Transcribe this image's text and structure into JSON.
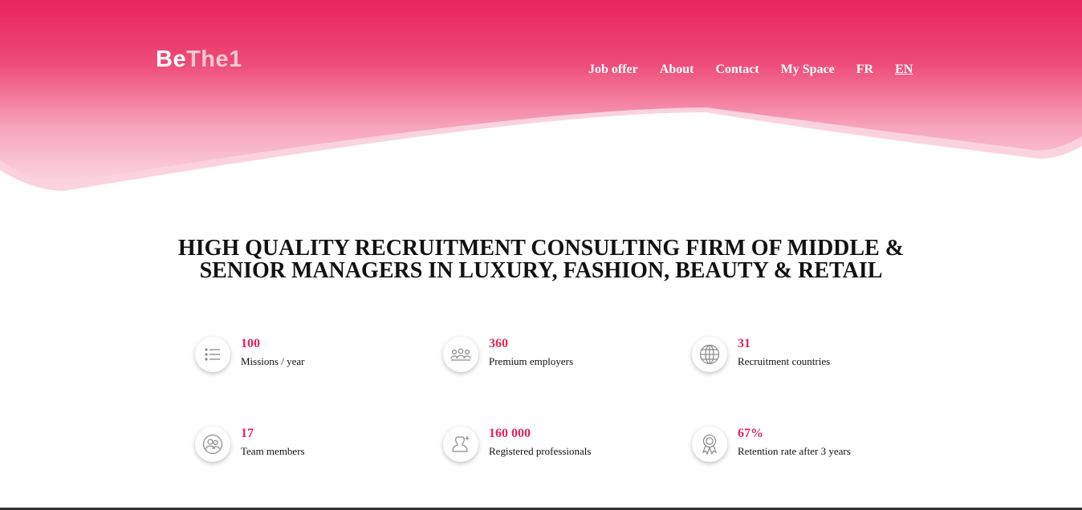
{
  "brand": {
    "logo_be": "Be",
    "logo_rest": "The1"
  },
  "nav": {
    "items": [
      {
        "label": "Job offer"
      },
      {
        "label": "About"
      },
      {
        "label": "Contact"
      },
      {
        "label": "My Space"
      },
      {
        "label": "FR"
      },
      {
        "label": "EN"
      }
    ]
  },
  "headline": {
    "line1": "HIGH QUALITY RECRUITMENT CONSULTING FIRM OF MIDDLE &",
    "line2": "SENIOR MANAGERS IN LUXURY, FASHION, BEAUTY & RETAIL"
  },
  "stats": [
    {
      "value": "100",
      "label": "Missions / year",
      "icon": "list-icon"
    },
    {
      "value": "360",
      "label": "Premium employers",
      "icon": "group-icon"
    },
    {
      "value": "31",
      "label": "Recruitment countries",
      "icon": "globe-icon"
    },
    {
      "value": "17",
      "label": "Team members",
      "icon": "team-icon"
    },
    {
      "value": "160 000",
      "label": "Registered professionals",
      "icon": "person-plus-icon"
    },
    {
      "value": "67%",
      "label": "Retention rate after 3 years",
      "icon": "award-icon"
    }
  ],
  "colors": {
    "accent": "#e4245a",
    "hero_top": "#e8245b",
    "hero_light": "#f8c9d6"
  }
}
